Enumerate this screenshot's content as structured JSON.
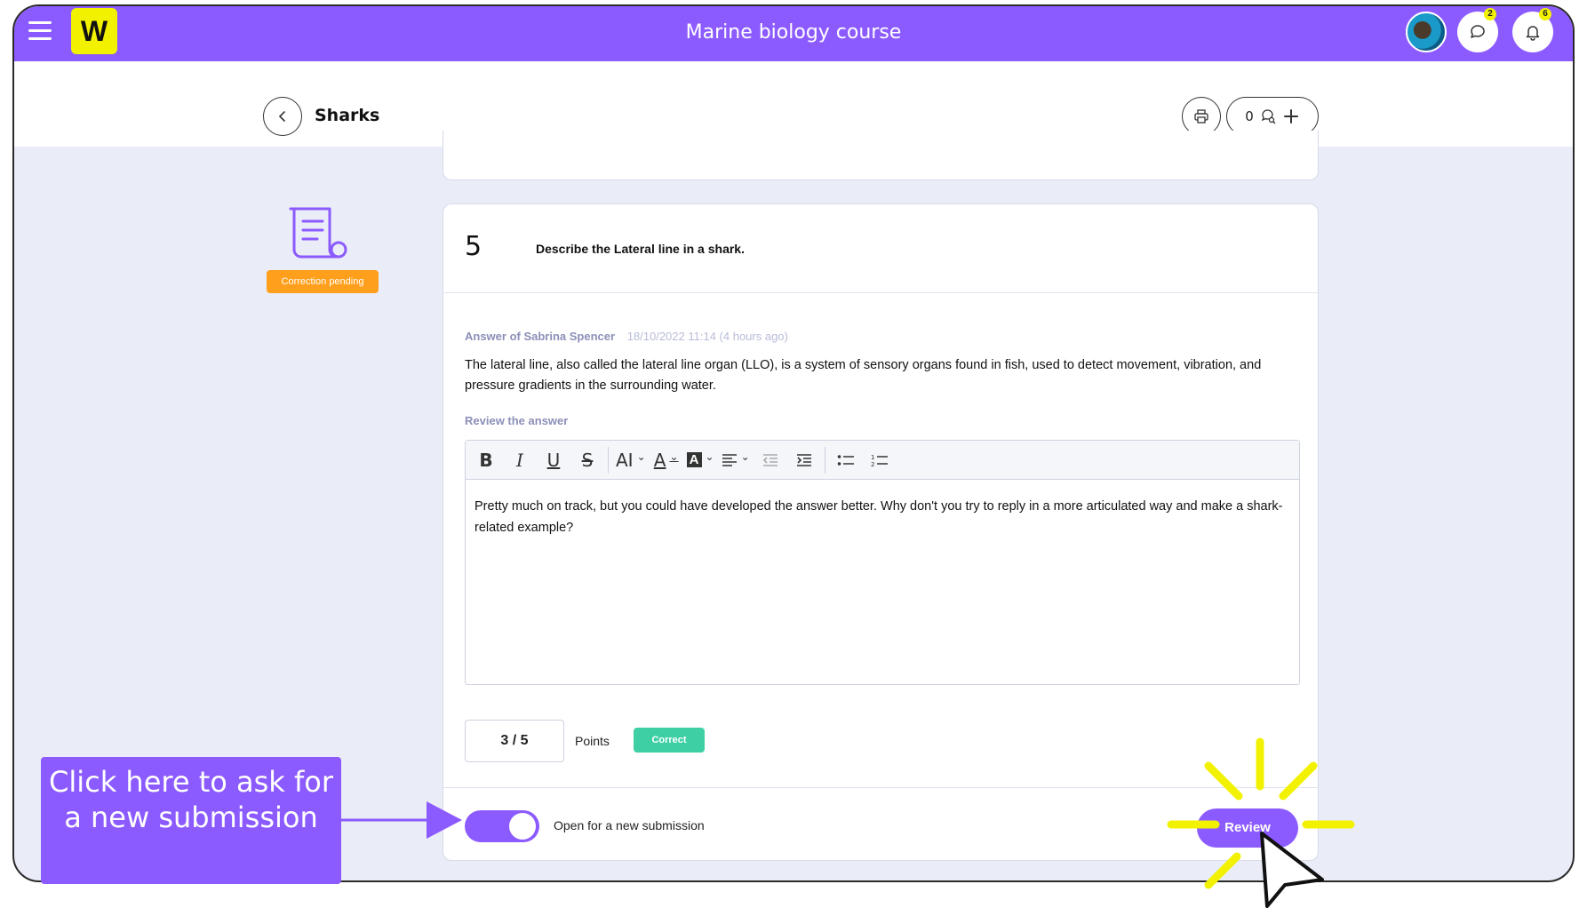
{
  "app": {
    "title": "Marine biology course",
    "chat_badge": "2",
    "notifications_badge": "6",
    "brand_color": "#8c5bff",
    "logo_letter": "W"
  },
  "subheader": {
    "title": "Sharks",
    "comment_count": "0"
  },
  "status": {
    "label": "Correction pending"
  },
  "question": {
    "number": "5",
    "text": "Describe the Lateral line in a shark."
  },
  "answer": {
    "author": "Answer of Sabrina Spencer",
    "date": "18/10/2022 11:14 (4 hours ago)",
    "text": "The lateral line, also called the lateral line organ (LLO), is a system of sensory organs found in fish, used to detect movement, vibration, and pressure gradients in the surrounding water."
  },
  "review": {
    "label": "Review the answer",
    "toolbar": [
      "bold",
      "italic",
      "underline",
      "strikethrough",
      "font-size",
      "font-color",
      "highlight-color",
      "align",
      "outdent",
      "indent",
      "bullet-list",
      "numbered-list"
    ],
    "text": "Pretty much on track, but you could have developed the answer better. Why don't you try to reply in a more articulated way and make a shark-related example?"
  },
  "grading": {
    "score": "3 / 5",
    "points_label": "Points",
    "result_badge": "Correct"
  },
  "footer": {
    "toggle_label": "Open for a new submission",
    "toggle_on": true,
    "review_button": "Review"
  },
  "callout": {
    "text": "Click here to ask for a new submission"
  }
}
